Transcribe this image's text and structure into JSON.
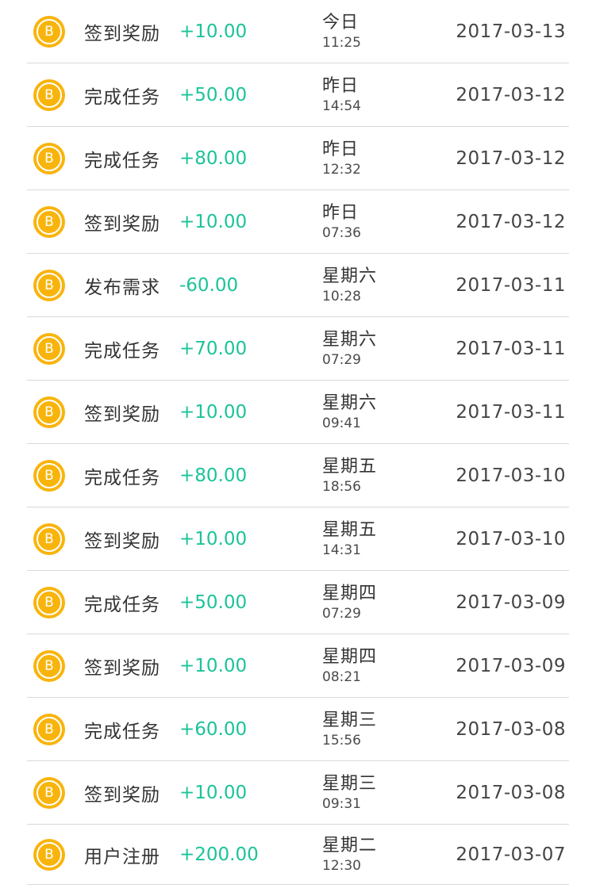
{
  "colors": {
    "coin": "#f9b40c",
    "amount_positive": "#1cc39a",
    "amount_negative": "#1cc39a",
    "divider": "#d9d9d9",
    "text": "#333333"
  },
  "coin_icon": {
    "name": "coin-b-icon",
    "glyph": "B"
  },
  "records": [
    {
      "type": "签到奖励",
      "amount": "+10.00",
      "day": "今日",
      "time": "11:25",
      "date": "2017-03-13"
    },
    {
      "type": "完成任务",
      "amount": "+50.00",
      "day": "昨日",
      "time": "14:54",
      "date": "2017-03-12"
    },
    {
      "type": "完成任务",
      "amount": "+80.00",
      "day": "昨日",
      "time": "12:32",
      "date": "2017-03-12"
    },
    {
      "type": "签到奖励",
      "amount": "+10.00",
      "day": "昨日",
      "time": "07:36",
      "date": "2017-03-12"
    },
    {
      "type": "发布需求",
      "amount": "-60.00",
      "day": "星期六",
      "time": "10:28",
      "date": "2017-03-11"
    },
    {
      "type": "完成任务",
      "amount": "+70.00",
      "day": "星期六",
      "time": "07:29",
      "date": "2017-03-11"
    },
    {
      "type": "签到奖励",
      "amount": "+10.00",
      "day": "星期六",
      "time": "09:41",
      "date": "2017-03-11"
    },
    {
      "type": "完成任务",
      "amount": "+80.00",
      "day": "星期五",
      "time": "18:56",
      "date": "2017-03-10"
    },
    {
      "type": "签到奖励",
      "amount": "+10.00",
      "day": "星期五",
      "time": "14:31",
      "date": "2017-03-10"
    },
    {
      "type": "完成任务",
      "amount": "+50.00",
      "day": "星期四",
      "time": "07:29",
      "date": "2017-03-09"
    },
    {
      "type": "签到奖励",
      "amount": "+10.00",
      "day": "星期四",
      "time": "08:21",
      "date": "2017-03-09"
    },
    {
      "type": "完成任务",
      "amount": "+60.00",
      "day": "星期三",
      "time": "15:56",
      "date": "2017-03-08"
    },
    {
      "type": "签到奖励",
      "amount": "+10.00",
      "day": "星期三",
      "time": "09:31",
      "date": "2017-03-08"
    },
    {
      "type": "用户注册",
      "amount": "+200.00",
      "day": "星期二",
      "time": "12:30",
      "date": "2017-03-07"
    }
  ]
}
